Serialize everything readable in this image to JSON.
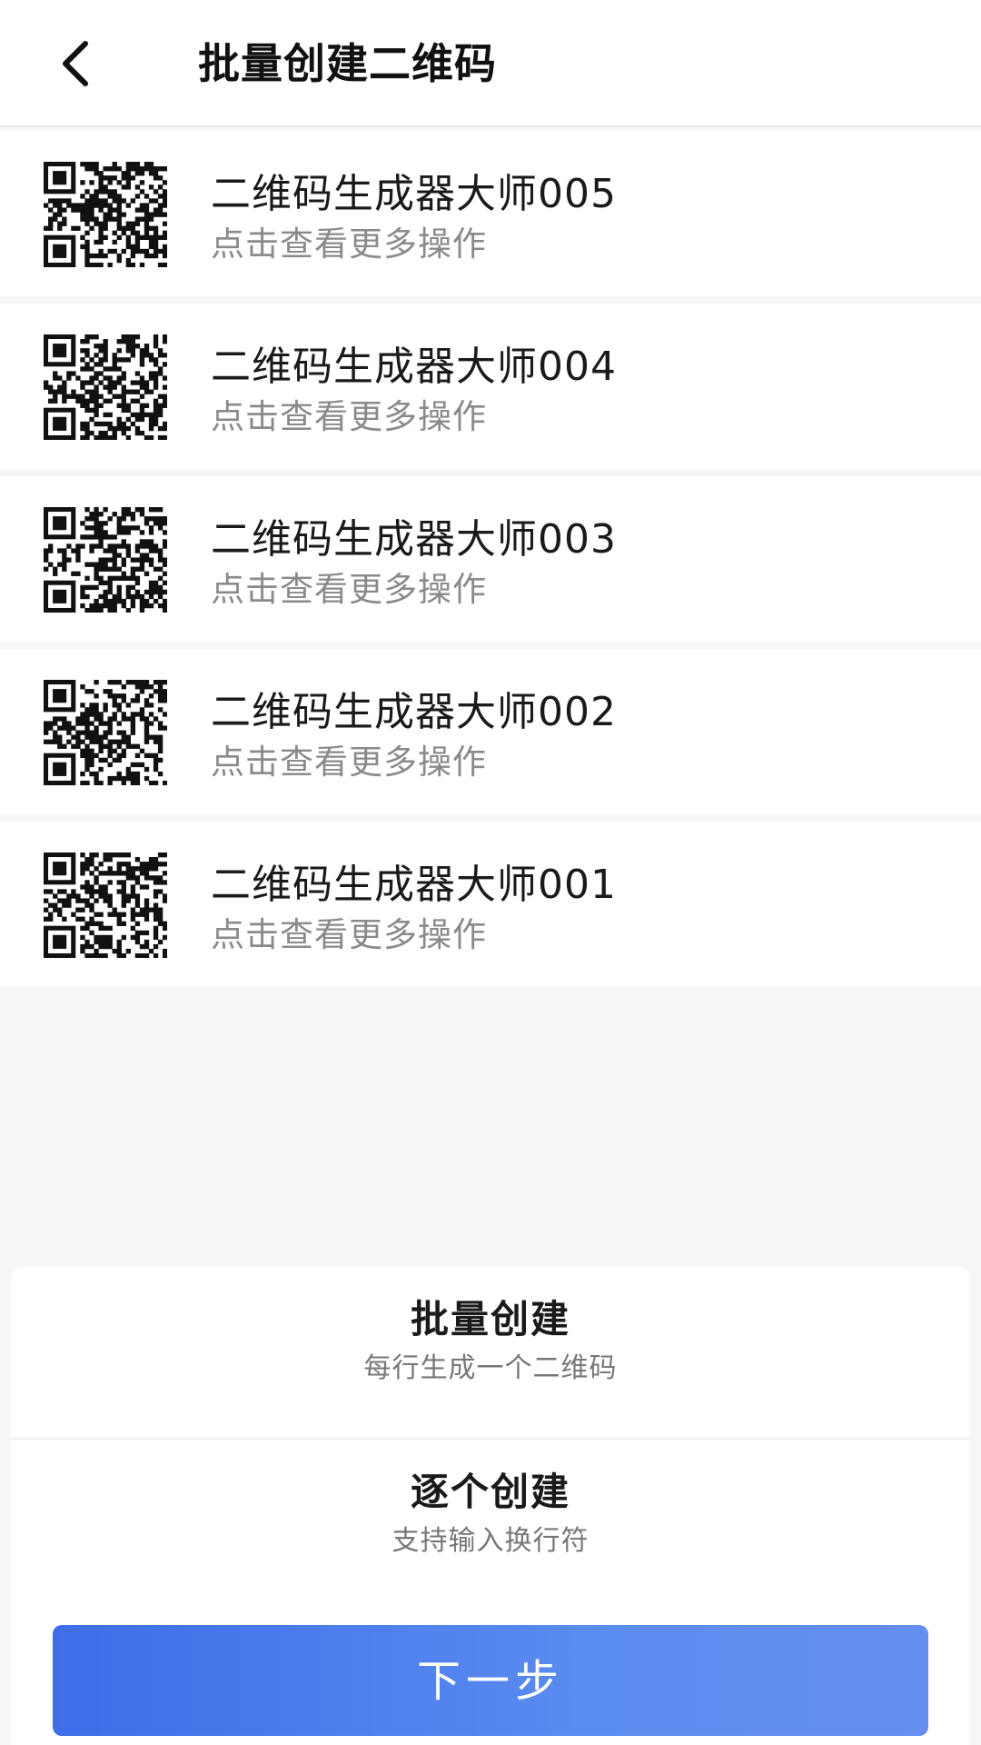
{
  "header": {
    "title": "批量创建二维码",
    "back_icon": "chevron-left-icon"
  },
  "list": {
    "items": [
      {
        "title": "二维码生成器大师005",
        "subtitle": "点击查看更多操作",
        "seed": 5
      },
      {
        "title": "二维码生成器大师004",
        "subtitle": "点击查看更多操作",
        "seed": 4
      },
      {
        "title": "二维码生成器大师003",
        "subtitle": "点击查看更多操作",
        "seed": 3
      },
      {
        "title": "二维码生成器大师002",
        "subtitle": "点击查看更多操作",
        "seed": 2
      },
      {
        "title": "二维码生成器大师001",
        "subtitle": "点击查看更多操作",
        "seed": 1
      }
    ]
  },
  "options": {
    "batch": {
      "title": "批量创建",
      "subtitle": "每行生成一个二维码"
    },
    "single": {
      "title": "逐个创建",
      "subtitle": "支持输入换行符"
    }
  },
  "actions": {
    "next_label": "下一步"
  },
  "colors": {
    "primary": "#3d6ee8",
    "text_primary": "#1a1a1a",
    "text_secondary": "#8a8a8a",
    "background": "#f6f6f6"
  }
}
